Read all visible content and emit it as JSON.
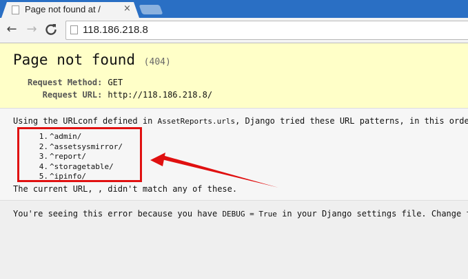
{
  "browser": {
    "tab_title": "Page not found at /",
    "tab_close_glyph": "×",
    "nav_back_glyph": "←",
    "nav_forward_glyph": "→",
    "nav_reload_glyph": "C",
    "url": "118.186.218.8"
  },
  "summary": {
    "title": "Page not found",
    "status": "(404)",
    "request_method_label": "Request Method:",
    "request_method_value": "GET",
    "request_url_label": "Request URL:",
    "request_url_value": "http://118.186.218.8/"
  },
  "info": {
    "intro_before": "Using the URLconf defined in ",
    "urlconf": "AssetReports.urls",
    "intro_after": ", Django tried these URL patterns, in this order:",
    "patterns": [
      {
        "num": "1.",
        "pattern": "^admin/"
      },
      {
        "num": "2.",
        "pattern": "^assetsysmirror/"
      },
      {
        "num": "3.",
        "pattern": "^report/"
      },
      {
        "num": "4.",
        "pattern": "^storagetable/"
      },
      {
        "num": "5.",
        "pattern": "^ipinfo/"
      }
    ],
    "footer": "The current URL, , didn't match any of these."
  },
  "explanation": {
    "before": "You're seeing this error because you have ",
    "debug_code": "DEBUG = True",
    "after": " in your Django settings file. Change that"
  },
  "annotation": {
    "color": "#e01010"
  }
}
